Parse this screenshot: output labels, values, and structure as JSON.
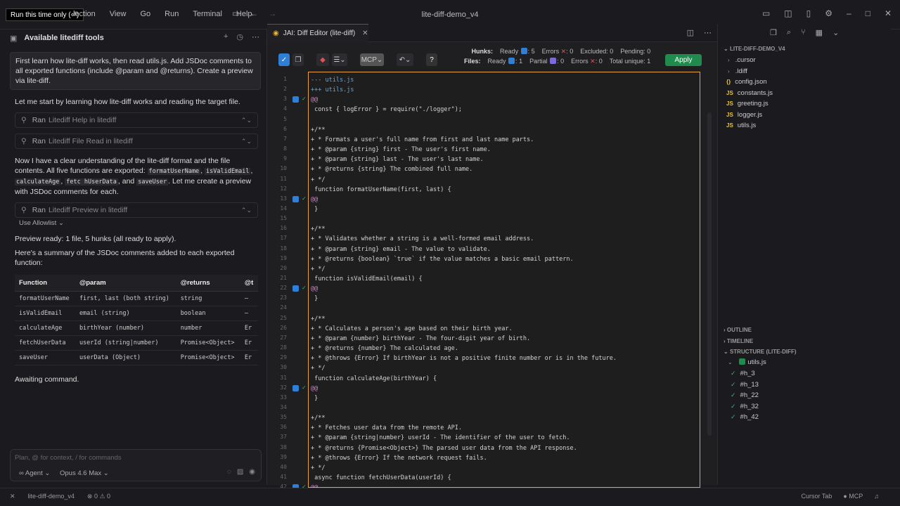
{
  "titlebar": {
    "hint": "Run this time only (⏎)",
    "menu": [
      "lection",
      "View",
      "Go",
      "Run",
      "Terminal",
      "Help"
    ],
    "title": "lite-diff-demo_v4"
  },
  "chat": {
    "header": "Available litediff tools",
    "prompt": "First learn how lite-diff works, then read utils.js. Add JSDoc comments to all exported functions (include @param and @returns). Create a preview via lite-diff.",
    "p1": "Let me start by learning how lite-diff works and reading the target file.",
    "tool1": {
      "ran": "Ran",
      "name": "Litediff Help in litediff"
    },
    "tool2": {
      "ran": "Ran",
      "name": "Litediff File Read in litediff"
    },
    "p2a": "Now I have a clear understanding of the lite-diff format and the file contents. All five functions are exported:",
    "p2_funcs": [
      "formatUserName",
      "isValidEmail",
      "calculateAge",
      "fetc hUserData",
      "saveUser"
    ],
    "p2b": ". Let me create a preview with JSDoc comments for each.",
    "p2_and": ", and",
    "tool3": {
      "ran": "Ran",
      "name": "Litediff Preview in litediff"
    },
    "allowlist": "Use Allowlist",
    "p3": "Preview ready: 1 file, 5 hunks (all ready to apply).",
    "p4": "Here's a summary of the JSDoc comments added to each exported function:",
    "table": {
      "headers": [
        "Function",
        "@param",
        "@returns",
        "@t"
      ],
      "rows": [
        [
          "formatUserName",
          "first, last (both string)",
          "string",
          "—"
        ],
        [
          "isValidEmail",
          "email (string)",
          "boolean",
          "—"
        ],
        [
          "calculateAge",
          "birthYear (number)",
          "number",
          "Er"
        ],
        [
          "fetchUserData",
          "userId (string|number)",
          "Promise<Object>",
          "Er"
        ],
        [
          "saveUser",
          "userData (Object)",
          "Promise<Object>",
          "Er"
        ]
      ]
    },
    "awaiting": "Awaiting command.",
    "input_placeholder": "Plan, @ for context, / for commands",
    "agent": "Agent",
    "model": "Opus 4.6 Max"
  },
  "editor": {
    "tab_label": "JAI: Diff Editor (lite-diff)",
    "mcp_label": "MCP",
    "stats": {
      "hunks_label": "Hunks:",
      "ready": "Ready",
      "ready_n": "5",
      "errors": "Errors",
      "errors_n": "0",
      "excluded": "Excluded: 0",
      "pending": "Pending: 0",
      "files_label": "Files:",
      "f_ready_n": "1",
      "partial": "Partial",
      "partial_n": "0",
      "f_errors_n": "0",
      "total": "Total unique: 1"
    },
    "apply_label": "Apply",
    "lines": [
      {
        "n": "1",
        "t": "--- utils.js",
        "k": "hdr"
      },
      {
        "n": "2",
        "t": "+++ utils.js",
        "k": "hdr"
      },
      {
        "n": "3",
        "t": "@@",
        "k": "hunk",
        "h": true
      },
      {
        "n": "4",
        "t": " const { logError } = require(\"./logger\");",
        "k": ""
      },
      {
        "n": "5",
        "t": "",
        "k": ""
      },
      {
        "n": "6",
        "t": "+/**",
        "k": "add"
      },
      {
        "n": "7",
        "t": "+ * Formats a user's full name from first and last name parts.",
        "k": "add"
      },
      {
        "n": "8",
        "t": "+ * @param {string} first - The user's first name.",
        "k": "add"
      },
      {
        "n": "9",
        "t": "+ * @param {string} last - The user's last name.",
        "k": "add"
      },
      {
        "n": "10",
        "t": "+ * @returns {string} The combined full name.",
        "k": "add"
      },
      {
        "n": "11",
        "t": "+ */",
        "k": "add"
      },
      {
        "n": "12",
        "t": " function formatUserName(first, last) {",
        "k": ""
      },
      {
        "n": "13",
        "t": "@@",
        "k": "hunk",
        "h": true
      },
      {
        "n": "14",
        "t": " }",
        "k": ""
      },
      {
        "n": "15",
        "t": "",
        "k": ""
      },
      {
        "n": "16",
        "t": "+/**",
        "k": "add"
      },
      {
        "n": "17",
        "t": "+ * Validates whether a string is a well-formed email address.",
        "k": "add"
      },
      {
        "n": "18",
        "t": "+ * @param {string} email - The value to validate.",
        "k": "add"
      },
      {
        "n": "19",
        "t": "+ * @returns {boolean} `true` if the value matches a basic email pattern.",
        "k": "add"
      },
      {
        "n": "20",
        "t": "+ */",
        "k": "add"
      },
      {
        "n": "21",
        "t": " function isValidEmail(email) {",
        "k": ""
      },
      {
        "n": "22",
        "t": "@@",
        "k": "hunk",
        "h": true
      },
      {
        "n": "23",
        "t": " }",
        "k": ""
      },
      {
        "n": "24",
        "t": "",
        "k": ""
      },
      {
        "n": "25",
        "t": "+/**",
        "k": "add"
      },
      {
        "n": "26",
        "t": "+ * Calculates a person's age based on their birth year.",
        "k": "add"
      },
      {
        "n": "27",
        "t": "+ * @param {number} birthYear - The four-digit year of birth.",
        "k": "add"
      },
      {
        "n": "28",
        "t": "+ * @returns {number} The calculated age.",
        "k": "add"
      },
      {
        "n": "29",
        "t": "+ * @throws {Error} If birthYear is not a positive finite number or is in the future.",
        "k": "add"
      },
      {
        "n": "30",
        "t": "+ */",
        "k": "add"
      },
      {
        "n": "31",
        "t": " function calculateAge(birthYear) {",
        "k": ""
      },
      {
        "n": "32",
        "t": "@@",
        "k": "hunk",
        "h": true
      },
      {
        "n": "33",
        "t": " }",
        "k": ""
      },
      {
        "n": "34",
        "t": "",
        "k": ""
      },
      {
        "n": "35",
        "t": "+/**",
        "k": "add"
      },
      {
        "n": "36",
        "t": "+ * Fetches user data from the remote API.",
        "k": "add"
      },
      {
        "n": "37",
        "t": "+ * @param {string|number} userId - The identifier of the user to fetch.",
        "k": "add"
      },
      {
        "n": "38",
        "t": "+ * @returns {Promise<Object>} The parsed user data from the API response.",
        "k": "add"
      },
      {
        "n": "39",
        "t": "+ * @throws {Error} If the network request fails.",
        "k": "add"
      },
      {
        "n": "40",
        "t": "+ */",
        "k": "add"
      },
      {
        "n": "41",
        "t": " async function fetchUserData(userId) {",
        "k": ""
      },
      {
        "n": "42",
        "t": "@@",
        "k": "hunk",
        "h": true
      }
    ]
  },
  "explorer": {
    "root": "LITE-DIFF-DEMO_V4",
    "folders": [
      ".cursor",
      ".ldiff"
    ],
    "files": [
      {
        "name": "config.json",
        "type": "json"
      },
      {
        "name": "constants.js",
        "type": "js"
      },
      {
        "name": "greeting.js",
        "type": "js"
      },
      {
        "name": "logger.js",
        "type": "js"
      },
      {
        "name": "utils.js",
        "type": "js"
      }
    ],
    "outline": "OUTLINE",
    "timeline": "TIMELINE",
    "structure": "STRUCTURE (LITE-DIFF)",
    "structure_file": "utils.js",
    "hunks": [
      "#h_3",
      "#h_13",
      "#h_22",
      "#h_32",
      "#h_42"
    ]
  },
  "statusbar": {
    "project": "lite-diff-demo_v4",
    "problems": "0 ⚠ 0",
    "cursor_tab": "Cursor Tab",
    "mcp": "MCP"
  },
  "colors": {
    "accent_blue": "#2f7fd6",
    "apply_green": "#1f8b4c",
    "diff_border": "#e8a33d",
    "error_red": "#e05252"
  }
}
